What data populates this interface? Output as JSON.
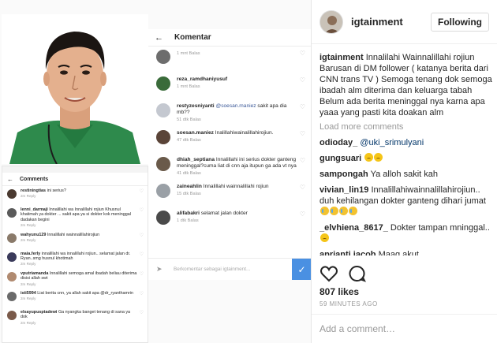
{
  "post": {
    "username": "igtainment",
    "follow_label": "Following",
    "caption_user": "igtainment",
    "caption_text": "Innalilahi Wainnalillahi rojiun Barusan di DM follower ( katanya berita dari CNN trans TV ) Semoga tenang dok semoga ibadah alm diterima dan keluarga tabah Belum ada berita meninggal nya karna apa yaaa yang pasti kita doakan alm",
    "load_more": "Load more comments",
    "likes": "807 likes",
    "time_ago": "59 MINUTES AGO",
    "add_comment_placeholder": "Add a comment…"
  },
  "comments": [
    {
      "user": "odioday_",
      "mention": "@uki_srimulyani",
      "text": "",
      "emoji": []
    },
    {
      "user": "gungsuari",
      "mention": "",
      "text": "",
      "emoji": [
        "sad",
        "sad"
      ]
    },
    {
      "user": "sampongah",
      "mention": "",
      "text": "Ya alloh sakit kah",
      "emoji": []
    },
    {
      "user": "vivian_lin19",
      "mention": "",
      "text": "Innalillahiwainnalillahirojiun.. duh kehilangan dokter ganteng dihari jumat",
      "emoji": [
        "cry",
        "cry",
        "cry",
        "cry"
      ]
    },
    {
      "user": "_elvhiena_8617_",
      "mention": "",
      "text": "Dokter tampan mninggal..",
      "emoji": [
        "sad"
      ]
    },
    {
      "user": "aprianti.jacob",
      "mention": "",
      "text": "Maag akut..",
      "emoji": []
    }
  ],
  "big_screenshot": {
    "title": "Komentar",
    "input_placeholder": "Berkomentar sebagai igtainment...",
    "items": [
      {
        "user": "",
        "text": "",
        "meta": "1 mnt  Balas"
      },
      {
        "user": "reza_ramdhaniyusuf",
        "text": "",
        "meta": "1 mnt  Balas"
      },
      {
        "user": "restyzesniyanti",
        "mention": "@soesan.maniez",
        "text": "sakit apa dia mb??",
        "meta": "51 dtk  Balas"
      },
      {
        "user": "soesan.maniez",
        "text": "Inalillahiwainalillahirojiun.",
        "meta": "47 dtk  Balas"
      },
      {
        "user": "dhiah_septiana",
        "text": "Innalillahi ini serius dokter ganteng meninggal?cuma liat di cnn aja itupun ga ada vt nya",
        "meta": "41 dtk  Balas"
      },
      {
        "user": "zaineahlin",
        "text": "Innalillahi wainnalillahi rojiun",
        "meta": "15 dtk  Balas"
      },
      {
        "user": "alifabakri",
        "text": "selamat jalan dokter",
        "meta": "1 dtk  Balas"
      }
    ]
  },
  "small_screenshot": {
    "title": "Comments",
    "items": [
      {
        "user": "restiningtias",
        "text": "ini serius?",
        "meta": "2m  Reply"
      },
      {
        "user": "lenni_darmaji",
        "text": "Innalillahi wa Innalillahi rojiun Khusnul khatimah ya dokter ... sakit apa ya si dokter kok meninggal dadakan begini",
        "meta": "2m  Reply"
      },
      {
        "user": "wahyunu129",
        "text": "Innalillahi wainnalillahirojiun",
        "meta": "2m  Reply"
      },
      {
        "user": "maia.ferly",
        "text": "innalillahi wa innalillahi rojiun.. selamat jalan dr. Ryan..smg husnul khotimah",
        "meta": "2m  Reply"
      },
      {
        "user": "vputriamanda",
        "text": "Innalillahi semoga amal ibadah beliau diterima disisi allah swt",
        "meta": "2m  Reply"
      },
      {
        "user": "isti5994",
        "text": "Liat berita cnn, ya allah sakit apa @dr_ryanthamrin",
        "meta": "2m  Reply"
      },
      {
        "user": "elsayupusptadewi",
        "text": "Ga nyangka banget tenang di sana ya dok",
        "meta": "2m  Reply"
      }
    ]
  }
}
